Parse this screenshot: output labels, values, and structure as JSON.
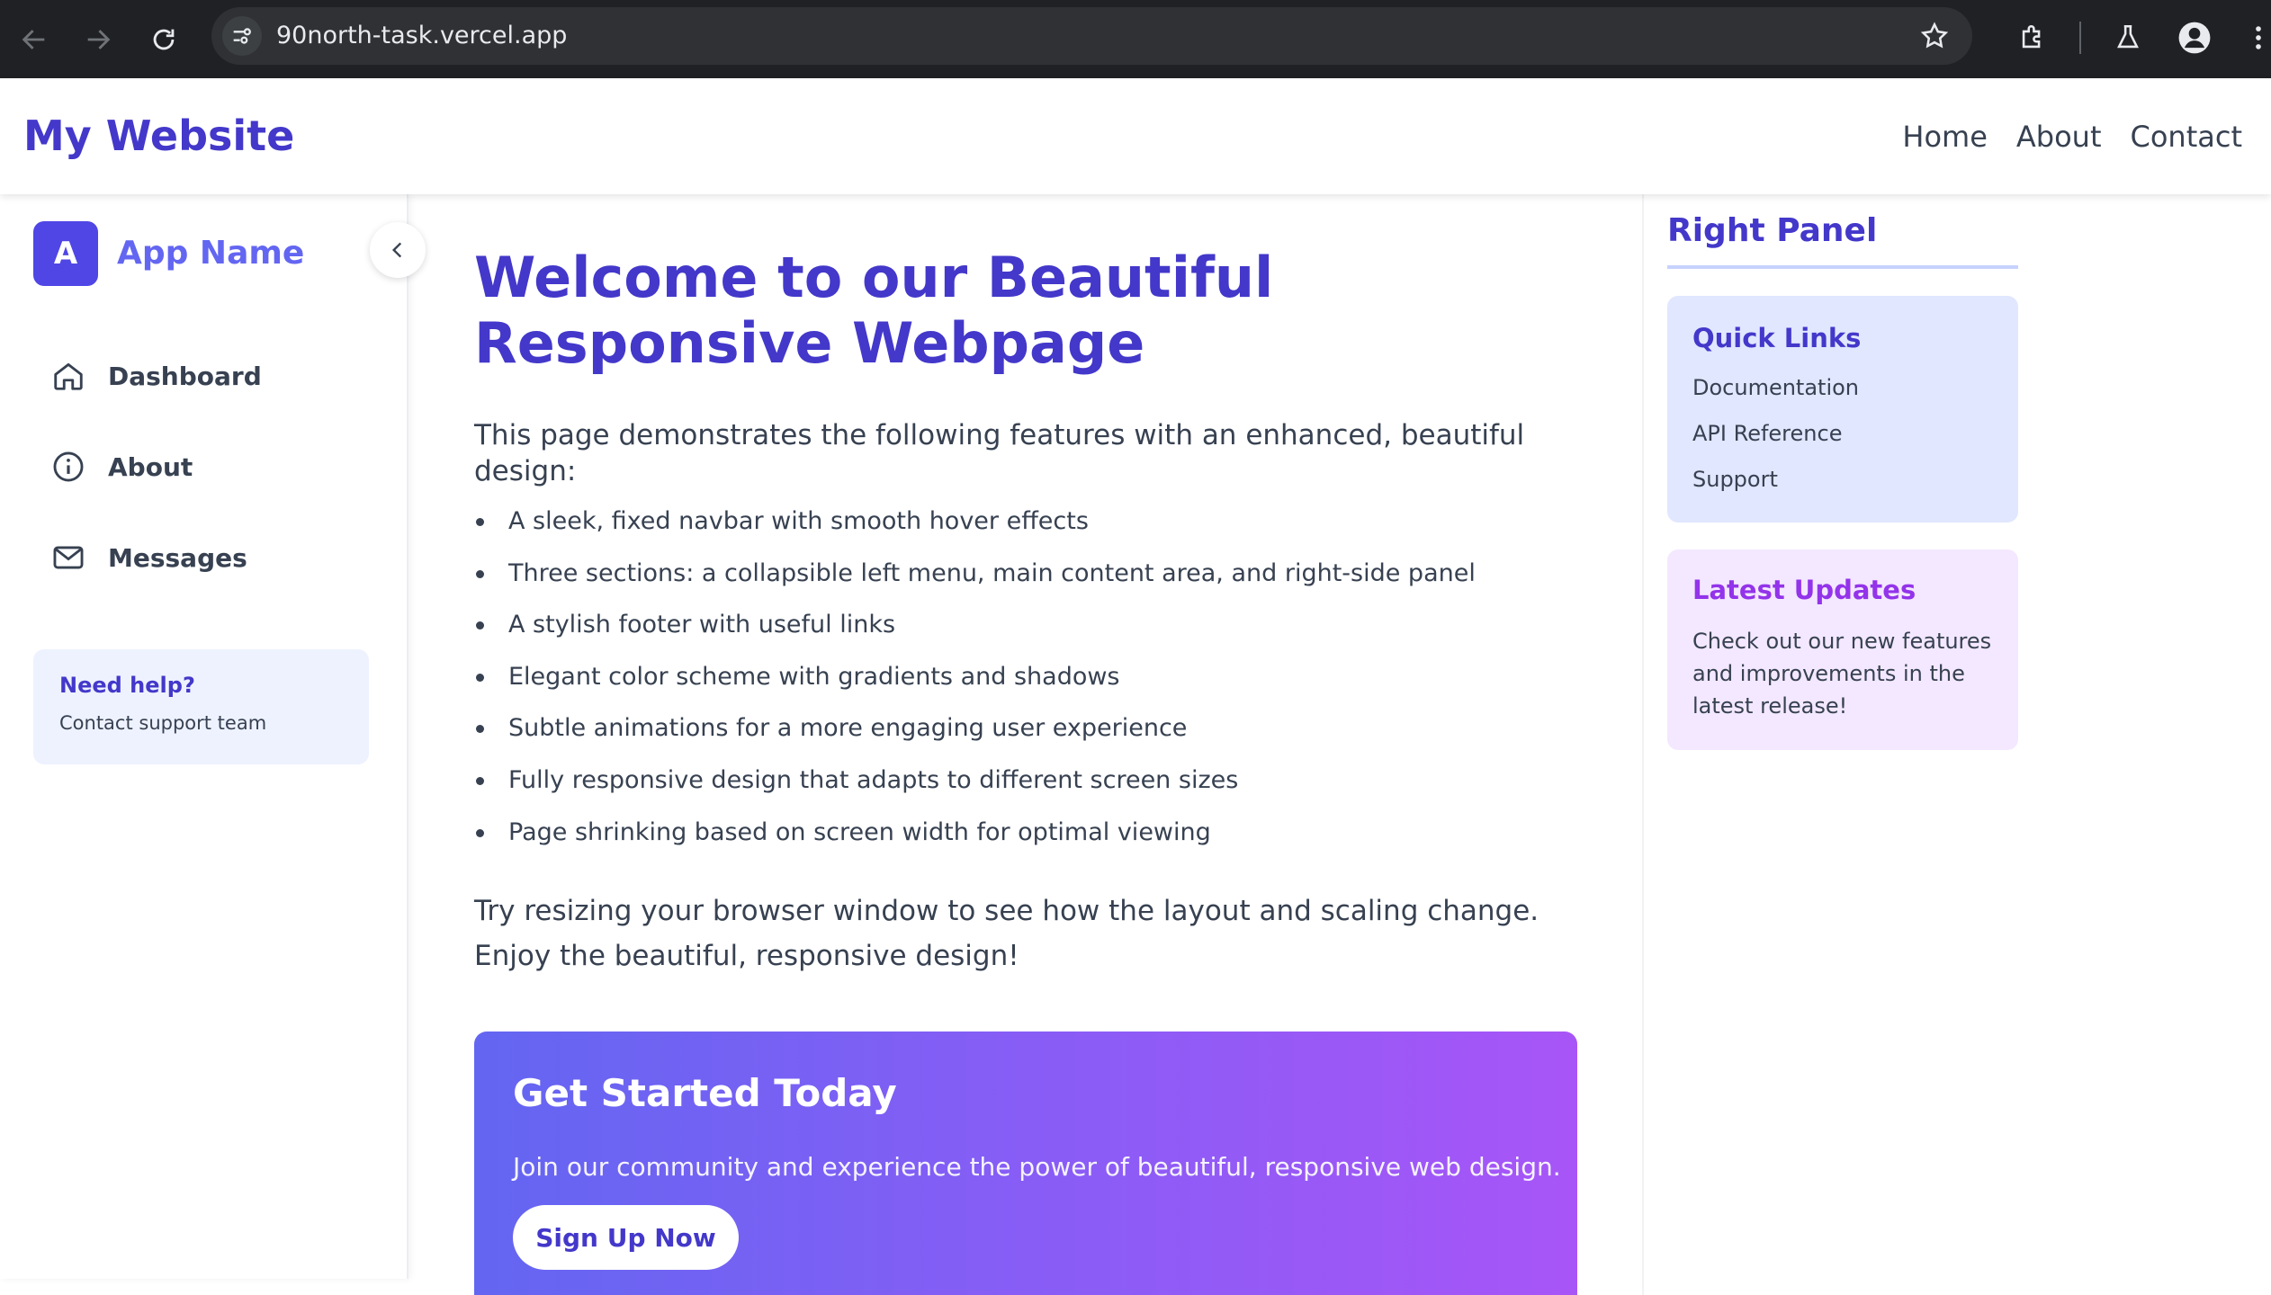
{
  "browser": {
    "url": "90north-task.vercel.app"
  },
  "navbar": {
    "brand": "My Website",
    "links": [
      "Home",
      "About",
      "Contact"
    ]
  },
  "sidebar": {
    "logo_letter": "A",
    "app_name": "App Name",
    "items": [
      {
        "label": "Dashboard",
        "icon": "home-icon"
      },
      {
        "label": "About",
        "icon": "info-icon"
      },
      {
        "label": "Messages",
        "icon": "mail-icon"
      }
    ],
    "help": {
      "title": "Need help?",
      "subtitle": "Contact support team"
    }
  },
  "main": {
    "title": "Welcome to our Beautiful Responsive Webpage",
    "intro": "This page demonstrates the following features with an enhanced, beautiful design:",
    "features": [
      "A sleek, fixed navbar with smooth hover effects",
      "Three sections: a collapsible left menu, main content area, and right-side panel",
      "A stylish footer with useful links",
      "Elegant color scheme with gradients and shadows",
      "Subtle animations for a more engaging user experience",
      "Fully responsive design that adapts to different screen sizes",
      "Page shrinking based on screen width for optimal viewing"
    ],
    "outro": "Try resizing your browser window to see how the layout and scaling change. Enjoy the beautiful, responsive design!",
    "cta": {
      "title": "Get Started Today",
      "text": "Join our community and experience the power of beautiful, responsive web design.",
      "button": "Sign Up Now"
    }
  },
  "right_panel": {
    "title": "Right Panel",
    "quick_links": {
      "title": "Quick Links",
      "links": [
        "Documentation",
        "API Reference",
        "Support"
      ]
    },
    "updates": {
      "title": "Latest Updates",
      "body": "Check out our new features and improvements in the latest release!"
    }
  },
  "colors": {
    "primary": "#4338ca",
    "accent": "#6366f1",
    "purple": "#9333ea",
    "gradient_start": "#6366f1",
    "gradient_end": "#a855f7"
  }
}
